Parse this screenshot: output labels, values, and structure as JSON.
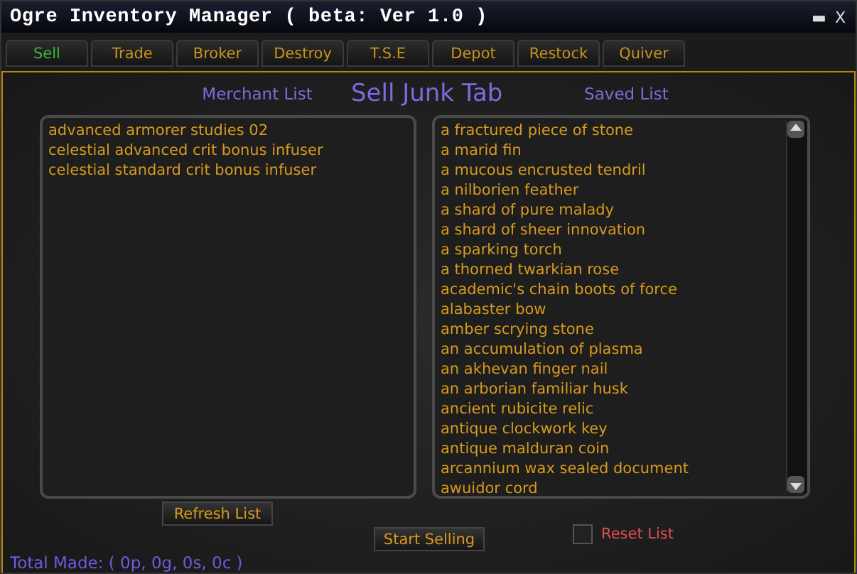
{
  "window": {
    "title": "Ogre Inventory Manager ( beta: Ver 1.0 )",
    "minimize": "▬",
    "close": "X"
  },
  "tabs": [
    {
      "label": "Sell",
      "selected": true
    },
    {
      "label": "Trade",
      "selected": false
    },
    {
      "label": "Broker",
      "selected": false
    },
    {
      "label": "Destroy",
      "selected": false
    },
    {
      "label": "T.S.E",
      "selected": false
    },
    {
      "label": "Depot",
      "selected": false
    },
    {
      "label": "Restock",
      "selected": false
    },
    {
      "label": "Quiver",
      "selected": false
    }
  ],
  "heading": "Sell Junk Tab",
  "merchant_list": {
    "title": "Merchant List",
    "items": [
      "advanced armorer studies 02",
      "celestial advanced crit bonus infuser",
      "celestial standard crit bonus infuser"
    ],
    "button": "Refresh List"
  },
  "saved_list": {
    "title": "Saved List",
    "items": [
      "a fractured piece of stone",
      "a marid fin",
      "a mucous encrusted tendril",
      "a nilborien feather",
      "a shard of pure malady",
      "a shard of sheer innovation",
      "a sparking torch",
      "a thorned twarkian rose",
      "academic's chain boots of force",
      "alabaster bow",
      "amber scrying stone",
      "an accumulation of plasma",
      "an akhevan finger nail",
      "an arborian familiar husk",
      "ancient rubicite relic",
      "antique clockwork key",
      "antique malduran coin",
      "arcannium wax sealed document",
      "awuidor cord"
    ]
  },
  "start_button": "Start Selling",
  "reset": {
    "label": "Reset List",
    "checked": false
  },
  "total": "Total Made: ( 0p, 0g, 0s, 0c )"
}
